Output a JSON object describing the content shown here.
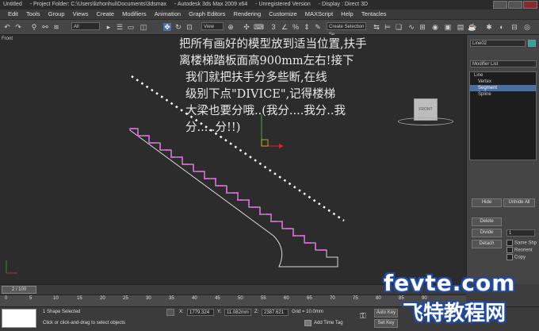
{
  "titlebar": {
    "app_label": "Untitled",
    "project": "- Project Folder: C:\\Users\\lizhonhui\\Documents\\3dsmax",
    "app_name": "- Autodesk 3ds Max  2009 x64",
    "version": "- Unregistered Version",
    "display": "- Display : Direct 3D"
  },
  "menu": [
    "Edit",
    "Tools",
    "Group",
    "Views",
    "Create",
    "Modifiers",
    "Animation",
    "Graph Editors",
    "Rendering",
    "Customize",
    "MAXScript",
    "Help",
    "Tentacles"
  ],
  "toolbar": {
    "selection_filter": "All",
    "reference_coord": "View",
    "named_selection": "Create Selection Se"
  },
  "viewport": {
    "label": "Front",
    "viewcube_label": "FRONT",
    "annotation_lines": [
      "把所有画好的模型放到适当位置,扶手",
      "离楼梯踏板面高900mm左右!接下",
      "我们就把扶手分多些断,在线",
      "级别下点\"DIVICE\",记得楼梯",
      "大梁也要分哦..(我分....我分..我",
      "分.....分!!)"
    ]
  },
  "panel": {
    "object_name": "Line02",
    "modifier_list": "Modifier List",
    "stack": [
      {
        "label": "Line",
        "selected": false
      },
      {
        "label": "Vertex",
        "selected": false
      },
      {
        "label": "Segment",
        "selected": true
      },
      {
        "label": "Spline",
        "selected": false
      }
    ],
    "buttons": {
      "hide": "Hide",
      "unhide_all": "Unhide All",
      "delete": "Delete",
      "divide": "Divide",
      "detach": "Detach"
    },
    "divide_value": "1",
    "checkboxes": [
      "Same Shp",
      "Reorient",
      "Copy"
    ]
  },
  "timeline": {
    "slider": "2 / 100",
    "ticks": [
      "0",
      "5",
      "10",
      "15",
      "20",
      "25",
      "30",
      "35",
      "40",
      "45",
      "50",
      "55",
      "60",
      "65",
      "70",
      "75",
      "80",
      "85",
      "90"
    ]
  },
  "status": {
    "selected": "1 Shape Selected",
    "prompt": "Click or click-and-drag to select objects",
    "x": "1779.324",
    "y": "11.082mm",
    "z": "2387.621",
    "grid": "Grid = 10.0mm",
    "auto_key": "Auto Key",
    "set_key": "Set Key",
    "add_time_tag": "Add Time Tag"
  },
  "watermark": {
    "line1": "fevte.com",
    "line2": "飞特教程网"
  }
}
